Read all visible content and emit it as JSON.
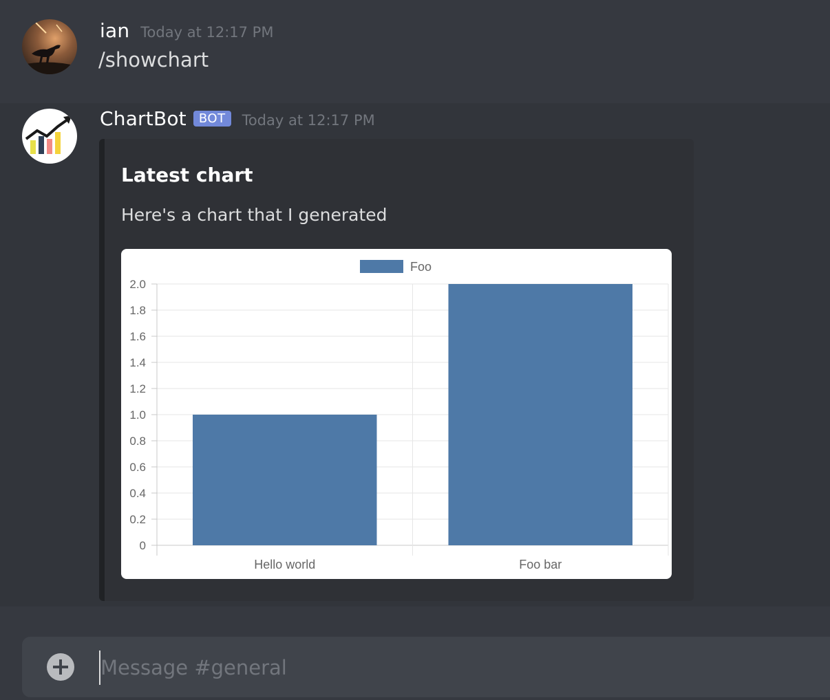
{
  "messages": [
    {
      "author": "ian",
      "timestamp": "Today at 12:17 PM",
      "content": "/showchart"
    },
    {
      "author": "ChartBot",
      "badge": "BOT",
      "timestamp": "Today at 12:17 PM",
      "embed": {
        "title": "Latest chart",
        "description": "Here's a chart that I generated"
      }
    }
  ],
  "input": {
    "placeholder": "Message #general"
  },
  "icons": {
    "attach": "plus-circle-icon",
    "avatar_ian": "dinosaur-avatar",
    "avatar_chartbot": "chart-logo-avatar"
  },
  "colors": {
    "bot_badge": "#7289da",
    "bar": "#4e79a7"
  },
  "chart_data": {
    "type": "bar",
    "categories": [
      "Hello world",
      "Foo bar"
    ],
    "series": [
      {
        "name": "Foo",
        "values": [
          1,
          2
        ]
      }
    ],
    "ylim": [
      0,
      2
    ],
    "yticks": [
      "0",
      "0.2",
      "0.4",
      "0.6",
      "0.8",
      "1.0",
      "1.2",
      "1.4",
      "1.6",
      "1.8",
      "2.0"
    ],
    "legend": "top",
    "grid": true
  }
}
